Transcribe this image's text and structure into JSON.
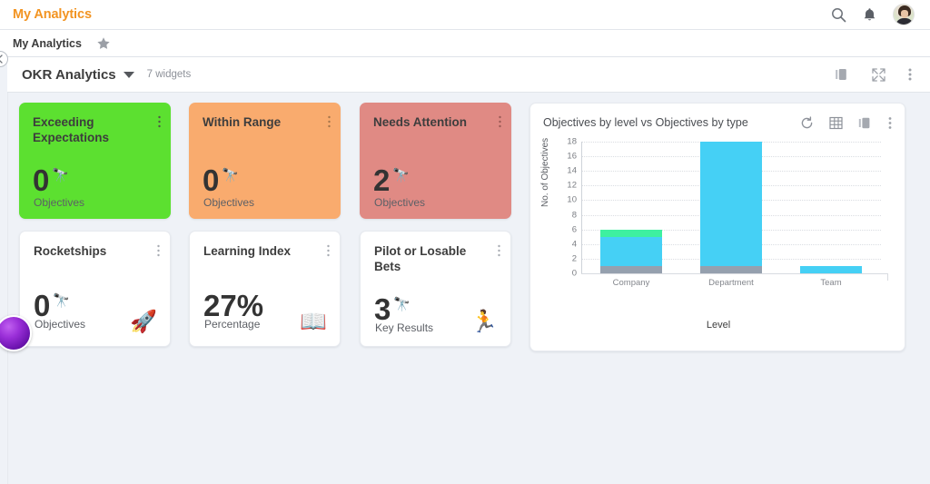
{
  "topbar": {
    "title": "My Analytics",
    "icons": [
      "search-icon",
      "bell-icon",
      "user-avatar"
    ]
  },
  "tabstrip": {
    "tab_label": "My Analytics",
    "star_icon": "star-icon"
  },
  "dashboard_header": {
    "title": "OKR Analytics",
    "widget_count": "7 widgets",
    "actions": [
      "panel-toggle-icon",
      "expand-icon",
      "more-options-icon"
    ]
  },
  "cards": [
    {
      "title": "Exceeding Expectations",
      "value": "0",
      "sup": "🔭",
      "sub": "Objectives",
      "emoji": "",
      "bg": "#5ce030"
    },
    {
      "title": "Within Range",
      "value": "0",
      "sup": "🔭",
      "sub": "Objectives",
      "emoji": "",
      "bg": "#f9ab6e"
    },
    {
      "title": "Needs Attention",
      "value": "2",
      "sup": "🔭",
      "sub": "Objectives",
      "emoji": "",
      "bg": "#e08a84"
    },
    {
      "title": "Rocketships",
      "value": "0",
      "sup": "🔭",
      "sub": "Objectives",
      "emoji": "🚀",
      "bg": "#ffffff"
    },
    {
      "title": "Learning Index",
      "value": "27%",
      "sup": "",
      "sub": "Percentage",
      "emoji": "📖",
      "bg": "#ffffff"
    },
    {
      "title": "Pilot or Losable Bets",
      "value": "3",
      "sup": "🔭",
      "sub": "Key Results",
      "emoji": "🏃",
      "bg": "#ffffff"
    }
  ],
  "chart_widget": {
    "title": "Objectives by level vs Objectives by type",
    "actions": [
      "refresh-icon",
      "table-view-icon",
      "panel-toggle-icon",
      "more-options-icon"
    ]
  },
  "chart_data": {
    "type": "bar",
    "stacked": true,
    "title": "Objectives by level vs Objectives by type",
    "xlabel": "Level",
    "ylabel": "No. of Objectives",
    "categories": [
      "Company",
      "Department",
      "Team"
    ],
    "yticks": [
      0,
      2,
      4,
      6,
      8,
      10,
      12,
      14,
      16,
      18
    ],
    "ylim": [
      0,
      18
    ],
    "grid": true,
    "legend": "none",
    "series": [
      {
        "name": "gray-series",
        "color": "#95a0ae",
        "values": [
          1,
          1,
          0
        ]
      },
      {
        "name": "cyan-series",
        "color": "#45d0f5",
        "values": [
          4,
          17,
          1
        ]
      },
      {
        "name": "green-series",
        "color": "#3ef0a0",
        "values": [
          1,
          0,
          0
        ]
      }
    ],
    "totals": [
      6,
      18,
      1
    ]
  },
  "colors": {
    "accent": "#f29422",
    "page_bg": "#eff2f7",
    "card_green": "#5ce030",
    "card_orange": "#f9ab6e",
    "card_red": "#e08a84",
    "bar_cyan": "#45d0f5",
    "bar_green": "#3ef0a0",
    "bar_gray": "#95a0ae"
  }
}
